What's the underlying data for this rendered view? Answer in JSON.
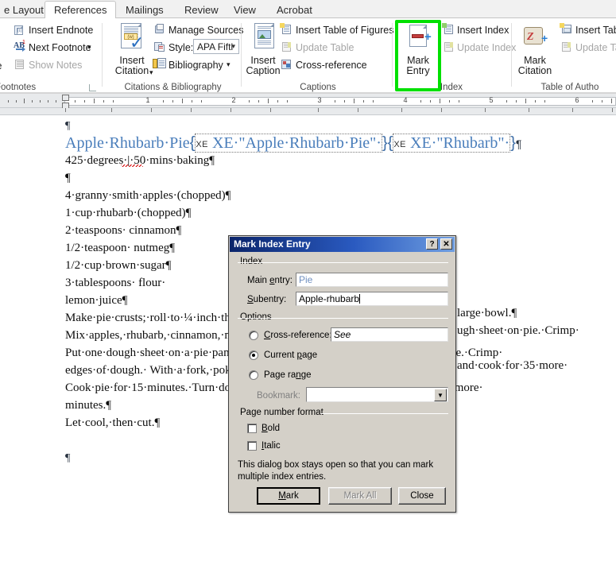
{
  "ribbon": {
    "tabs": [
      {
        "label": "e Layout",
        "active": false
      },
      {
        "label": "References",
        "active": true
      },
      {
        "label": "Mailings",
        "active": false
      },
      {
        "label": "Review",
        "active": false
      },
      {
        "label": "View",
        "active": false
      },
      {
        "label": "Acrobat",
        "active": false
      }
    ],
    "groups": {
      "footnotes": {
        "label": "Footnotes",
        "clipped_item": "te",
        "items": [
          {
            "label": "Insert Endnote",
            "icon": "insert-endnote-icon",
            "disabled": false
          },
          {
            "label": "Next Footnote",
            "icon": "next-footnote-icon",
            "disabled": false,
            "dropdown": true
          },
          {
            "label": "Show Notes",
            "icon": "show-notes-icon",
            "disabled": true
          }
        ],
        "dialog_launcher": "dialog-launcher-icon"
      },
      "citations": {
        "label": "Citations & Bibliography",
        "big": {
          "line1": "Insert",
          "line2": "Citation",
          "icon": "insert-citation-icon",
          "dropdown": true
        },
        "items": [
          {
            "label": "Manage Sources",
            "icon": "manage-sources-icon",
            "disabled": false
          },
          {
            "label": "Style:",
            "icon": "style-icon",
            "disabled": false
          },
          {
            "label": "Bibliography",
            "icon": "bibliography-icon",
            "disabled": false,
            "dropdown": true
          }
        ],
        "style_value": "APA Fiftl"
      },
      "captions": {
        "label": "Captions",
        "big": {
          "line1": "Insert",
          "line2": "Caption",
          "icon": "insert-caption-icon"
        },
        "items": [
          {
            "label": "Insert Table of Figures",
            "icon": "insert-table-of-figures-icon",
            "disabled": false
          },
          {
            "label": "Update Table",
            "icon": "update-table-icon",
            "disabled": true
          },
          {
            "label": "Cross-reference",
            "icon": "cross-reference-icon",
            "disabled": false
          }
        ]
      },
      "index": {
        "label": "Index",
        "big": {
          "line1": "Mark",
          "line2": "Entry",
          "icon": "mark-entry-icon",
          "highlighted": true
        },
        "items": [
          {
            "label": "Insert Index",
            "icon": "insert-index-icon",
            "disabled": false
          },
          {
            "label": "Update Index",
            "icon": "update-index-icon",
            "disabled": true
          }
        ]
      },
      "authorities": {
        "label": "Table of Autho",
        "big": {
          "line1": "Mark",
          "line2": "Citation",
          "icon": "mark-citation-icon"
        },
        "items": [
          {
            "label": "Insert Table",
            "icon": "insert-table-of-authorities-icon",
            "disabled": false
          },
          {
            "label": "Update Tab",
            "icon": "update-table-of-authorities-icon",
            "disabled": true
          }
        ]
      }
    },
    "highlight_color": "#00e000"
  },
  "ruler": {
    "numbers": [
      "1",
      "2",
      "3",
      "4",
      "5",
      "6"
    ]
  },
  "document": {
    "heading_text": "Apple·Rhubarb·Pie",
    "field1_open": "{",
    "field1": " XE·\"Apple·Rhubarb·Pie\"·",
    "field1_close": "}",
    "field2_open": "{",
    "field2": " XE·\"Rhubarb\"·",
    "field2_close": "}",
    "heading_pilcrow": "¶",
    "top_pilcrow": "¶",
    "lines": [
      {
        "text": "425·degrees·|·50·mins·baking¶",
        "misspelled": "mins"
      },
      {
        "text": "¶"
      },
      {
        "text": "4·granny·smith·apples·(chopped)¶"
      },
      {
        "text": "1·cup·rhubarb·(chopped)¶"
      },
      {
        "text": "2·teaspoons· cinnamon¶"
      },
      {
        "text": "1/2·teaspoon· nutmeg¶"
      },
      {
        "text": "1/2·cup·brown·sugar¶"
      },
      {
        "text": "3·tablespoons· flour·"
      },
      {
        "text": "lemon·juice¶"
      },
      {
        "text": "Make·pie·crusts;·roll·to·¼·inch·thick.¶"
      },
      {
        "text": "Mix·apples,·rhubarb,·cinnamon,·nutmeg,·sugar·and·flour·in·a·large·bowl.¶"
      },
      {
        "text": "Put·one·dough·sheet·on·a·pie·pan.·Pour·mixture·in.·Put·other·dough·sheet·on·pie.·Crimp·"
      },
      {
        "text": "edges·of·dough.· With·a·fork,·poke·holes·in·top·sheet.¶"
      },
      {
        "text": "Cook·pie·for·15·minutes.·Turn·down·oven·temperature·to·350·and·cook·for·35·more·"
      },
      {
        "text": "minutes.¶"
      },
      {
        "text": "Let·cool,·then·cut.¶"
      },
      {
        "text": ""
      },
      {
        "text": "¶"
      }
    ],
    "right_fragments": [
      {
        "text": "large·bowl.¶"
      },
      {
        "text": "ugh·sheet·on·pie.·Crimp·"
      },
      {
        "text": "and·cook·for·35·more·"
      }
    ]
  },
  "dialog": {
    "title": "Mark Index Entry",
    "help_button": "?",
    "close_button": "✕",
    "index_group_label": "Index",
    "main_entry_label": "Main entry:",
    "main_entry_value": "Pie",
    "subentry_label": "Subentry:",
    "subentry_value": "Apple-rhubarb",
    "options_group_label": "Options",
    "cross_reference_label": "Cross-reference:",
    "cross_reference_value": "See",
    "current_page_label": "Current page",
    "page_range_label": "Page range",
    "bookmark_label": "Bookmark:",
    "bookmark_value": "",
    "page_number_format_label": "Page number format",
    "bold_label": "Bold",
    "italic_label": "Italic",
    "note": "This dialog box stays open so that you can mark multiple index entries.",
    "buttons": {
      "mark": "Mark",
      "mark_all": "Mark All",
      "close": "Close"
    },
    "selected_option": "current_page"
  }
}
